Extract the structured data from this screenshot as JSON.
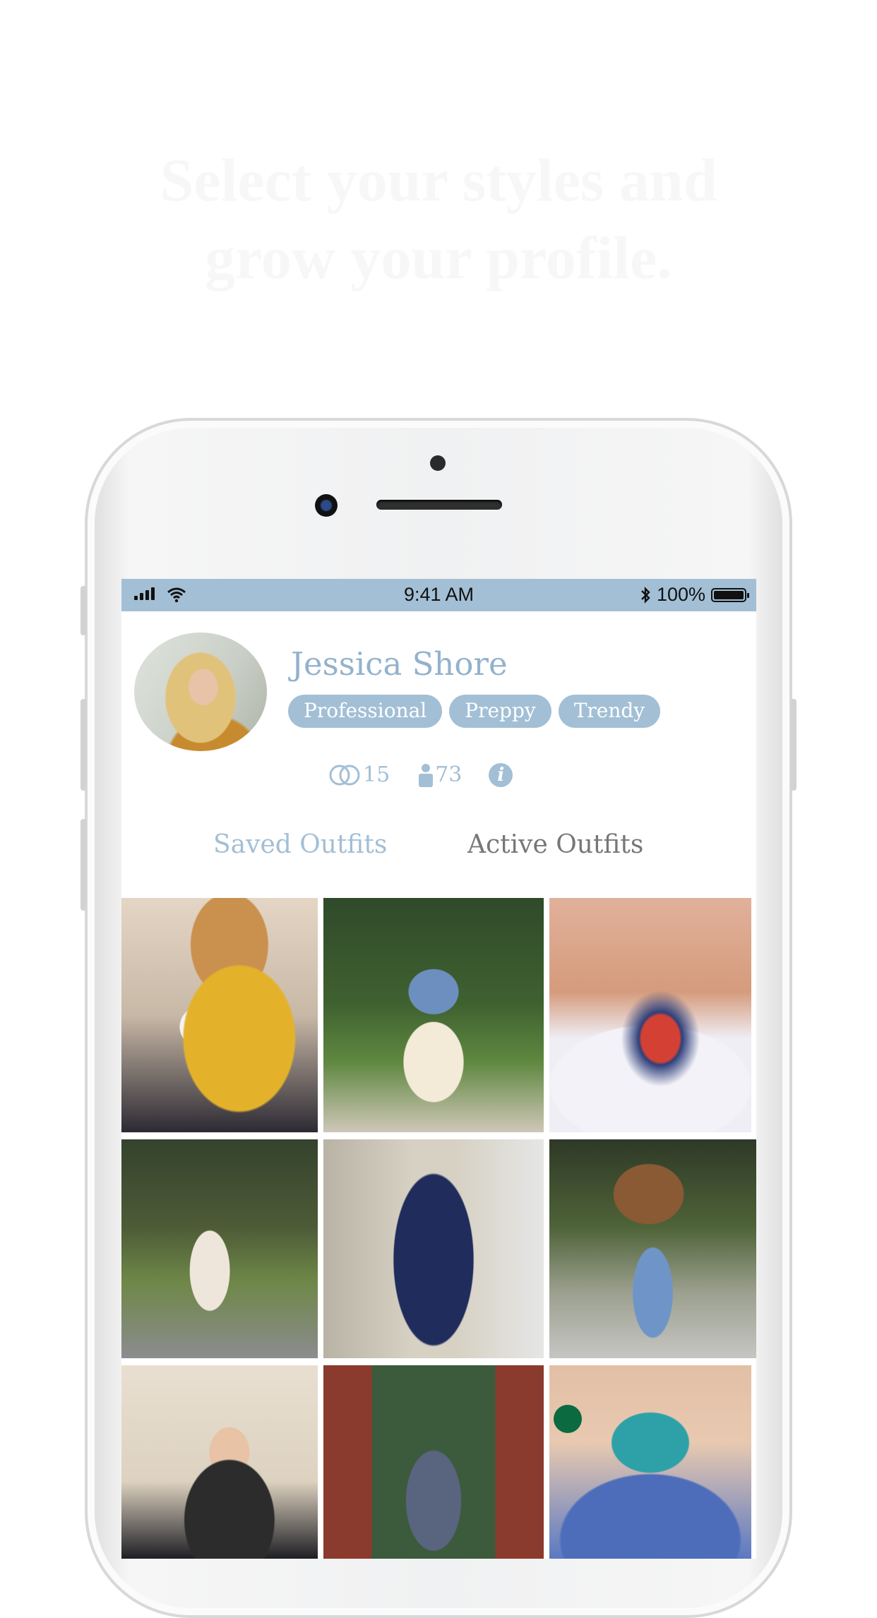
{
  "headline": {
    "line1": "Select your styles and",
    "line2": "grow your profile."
  },
  "status_bar": {
    "time": "9:41 AM",
    "battery": "100%"
  },
  "profile": {
    "name": "Jessica Shore",
    "tags": [
      "Professional",
      "Preppy",
      "Trendy"
    ],
    "stats": {
      "outfits": "15",
      "followers": "73"
    }
  },
  "tabs": {
    "saved": "Saved Outfits",
    "active": "Active Outfits"
  },
  "colors": {
    "accent": "#a2bfd5",
    "name_text": "#93b2cc",
    "inactive_tab": "#777777"
  },
  "icons": [
    "signal-icon",
    "wifi-icon",
    "bluetooth-icon",
    "battery-icon",
    "rings-icon",
    "person-icon",
    "info-icon"
  ]
}
